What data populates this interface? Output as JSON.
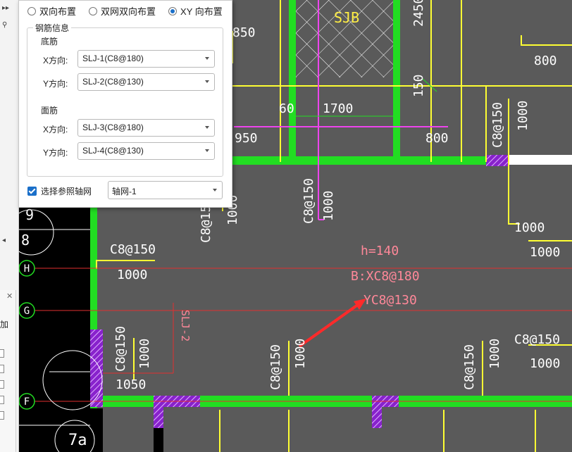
{
  "layout_radio": {
    "options": [
      "双向布置",
      "双网双向布置",
      "XY 向布置"
    ],
    "selected": "XY 向布置"
  },
  "rebar_info": {
    "title": "钢筋信息",
    "bottom": {
      "label": "底筋",
      "x_label": "X方向:",
      "x_value": "SLJ-1(C8@180)",
      "y_label": "Y方向:",
      "y_value": "SLJ-2(C8@130)"
    },
    "top": {
      "label": "面筋",
      "x_label": "X方向:",
      "x_value": "SLJ-3(C8@180)",
      "y_label": "Y方向:",
      "y_value": "SLJ-4(C8@130)"
    }
  },
  "axis_ref": {
    "checkbox_label": "选择参照轴网",
    "checked": true,
    "value": "轴网-1"
  },
  "side_panel": {
    "add_label": "加"
  },
  "drawing": {
    "dims": [
      "850",
      "2450",
      "800",
      "150",
      "60",
      "1700",
      "950",
      "800",
      "1000",
      "C8@150",
      "1000",
      "C8@150",
      "1000",
      "C8@150",
      "1000",
      "1000",
      "C8@150",
      "1000",
      "C8@150",
      "1000",
      "C8@150",
      "1000",
      "C8@150",
      "1000",
      "C8@150",
      "1000",
      "1050"
    ],
    "room_label": "SJB",
    "slab": {
      "h": "h=140",
      "bx": "B:XC8@180",
      "y": "YC8@130"
    },
    "rotated_label": "SLJ-2",
    "axis": {
      "H": "H",
      "G": "G",
      "F": "F",
      "n9": "9",
      "n8": "8",
      "n7a": "7a"
    },
    "colors": {
      "bg": "#5a5a5a",
      "wall": "#22dd22",
      "beam": "#ffff33",
      "magenta": "#ee44ee",
      "axis_red": "#e23030",
      "hatch": "#8822cc",
      "slab_text": "#ff8899"
    }
  }
}
